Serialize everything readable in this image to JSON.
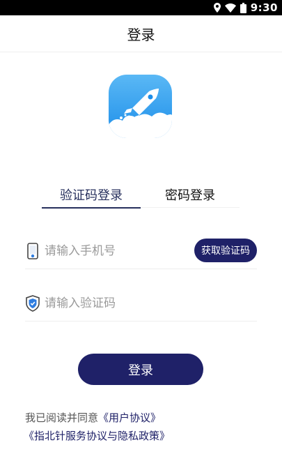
{
  "status_bar": {
    "time": "9:30",
    "icons": [
      "location-icon",
      "wifi-icon",
      "battery-icon"
    ]
  },
  "header": {
    "title": "登录"
  },
  "app_icon": {
    "name": "rocket-icon",
    "colors": {
      "top": "#5ab8f5",
      "bottom": "#1d8ee9",
      "cloud": "#ffffff"
    }
  },
  "tabs": [
    {
      "label": "验证码登录",
      "active": true
    },
    {
      "label": "密码登录",
      "active": false
    }
  ],
  "form": {
    "phone": {
      "placeholder": "请输入手机号",
      "value": "",
      "icon": "phone-icon"
    },
    "code": {
      "placeholder": "请输入验证码",
      "value": "",
      "icon": "shield-icon"
    },
    "get_code_label": "获取验证码"
  },
  "login_button": {
    "label": "登录"
  },
  "agreement": {
    "prefix": "我已阅读并同意",
    "user_agreement": "《用户协议》",
    "privacy_policy": "《指北针服务协议与隐私政策》"
  },
  "colors": {
    "primary": "#1f2168",
    "tab_active": "#262f5c",
    "placeholder": "#9a9a9a",
    "divider": "#eeeeee"
  }
}
